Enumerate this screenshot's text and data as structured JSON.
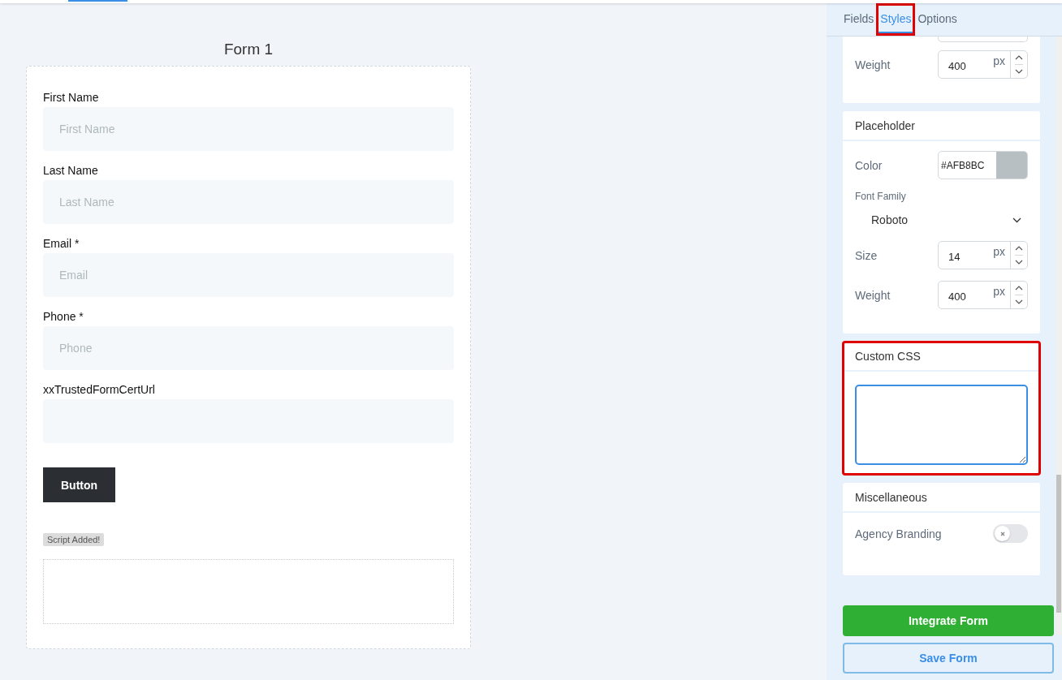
{
  "form": {
    "title": "Form 1",
    "fields": [
      {
        "label": "First Name",
        "placeholder": "First Name"
      },
      {
        "label": "Last Name",
        "placeholder": "Last Name"
      },
      {
        "label": "Email *",
        "placeholder": "Email"
      },
      {
        "label": "Phone *",
        "placeholder": "Phone"
      },
      {
        "label": "xxTrustedFormCertUrl"
      }
    ],
    "button": "Button",
    "badge": "Script Added!"
  },
  "panel": {
    "tabs": [
      {
        "label": "Fields",
        "selected": false,
        "highlighted": false
      },
      {
        "label": "Styles",
        "selected": true,
        "highlighted": true
      },
      {
        "label": "Options",
        "selected": false,
        "highlighted": false
      }
    ],
    "sections": [
      {
        "highlighted": false,
        "rows": [
          {
            "kind": "stepper",
            "label": "Weight",
            "value": "400",
            "unit": "px"
          }
        ]
      },
      {
        "title": "Placeholder",
        "highlighted": false,
        "rows": [
          {
            "kind": "color",
            "label": "Color",
            "value": "#AFB8BC"
          },
          {
            "kind": "select",
            "label": "Font Family",
            "value": "Roboto"
          },
          {
            "kind": "stepper",
            "label": "Size",
            "value": "14",
            "unit": "px"
          },
          {
            "kind": "stepper",
            "label": "Weight",
            "value": "400",
            "unit": "px"
          }
        ]
      },
      {
        "title": "Custom CSS",
        "highlighted": true,
        "rows": [
          {
            "kind": "textarea",
            "focused": true
          }
        ]
      },
      {
        "title": "Miscellaneous",
        "highlighted": false,
        "rows": [
          {
            "kind": "toggle",
            "label": "Agency Branding",
            "on": false
          }
        ]
      }
    ],
    "buttons": [
      {
        "label": "Integrate Form",
        "kind": "primary"
      },
      {
        "label": "Save Form",
        "kind": "outline"
      }
    ]
  }
}
